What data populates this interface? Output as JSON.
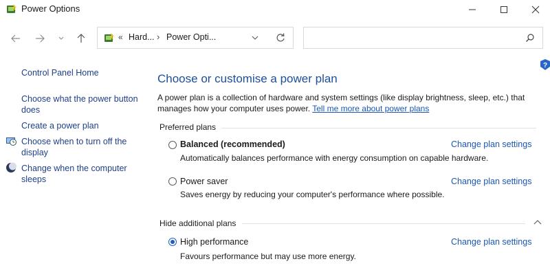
{
  "window": {
    "title": "Power Options",
    "app_icon": "power-options-icon",
    "controls": {
      "minimize": "minimize-icon",
      "maximize": "maximize-icon",
      "close": "close-icon"
    }
  },
  "nav": {
    "back_icon": "arrow-left-icon",
    "forward_icon": "arrow-right-icon",
    "recent_icon": "chevron-down-icon",
    "up_icon": "arrow-up-icon",
    "address": {
      "overflow": "«",
      "crumbs": [
        "Hard...",
        "Power Opti..."
      ],
      "separator": "›"
    },
    "search": {
      "value": "",
      "placeholder": ""
    }
  },
  "sidebar": {
    "home": "Control Panel Home",
    "items": [
      {
        "label": "Choose what the power button does",
        "icon": null
      },
      {
        "label": "Create a power plan",
        "icon": null
      },
      {
        "label": "Choose when to turn off the display",
        "icon": "display-timer-icon"
      },
      {
        "label": "Change when the computer sleeps",
        "icon": "moon-icon"
      }
    ]
  },
  "main": {
    "heading": "Choose or customise a power plan",
    "description": "A power plan is a collection of hardware and system settings (like display brightness, sleep, etc.) that manages how your computer uses power.",
    "learn_more": "Tell me more about power plans",
    "preferred_label": "Preferred plans",
    "additional_label": "Hide additional plans",
    "plans": [
      {
        "name": "Balanced (recommended)",
        "description": "Automatically balances performance with energy consumption on capable hardware.",
        "change": "Change plan settings",
        "selected": false,
        "bold": true
      },
      {
        "name": "Power saver",
        "description": "Saves energy by reducing your computer's performance where possible.",
        "change": "Change plan settings",
        "selected": false,
        "bold": false
      },
      {
        "name": "High performance",
        "description": "Favours performance but may use more energy.",
        "change": "Change plan settings",
        "selected": true,
        "bold": false
      }
    ]
  },
  "colors": {
    "link": "#1a56b4",
    "sidebar_link": "#1e3f8a",
    "heading": "#1c4e99",
    "radio_selected": "#1e5ebd"
  }
}
